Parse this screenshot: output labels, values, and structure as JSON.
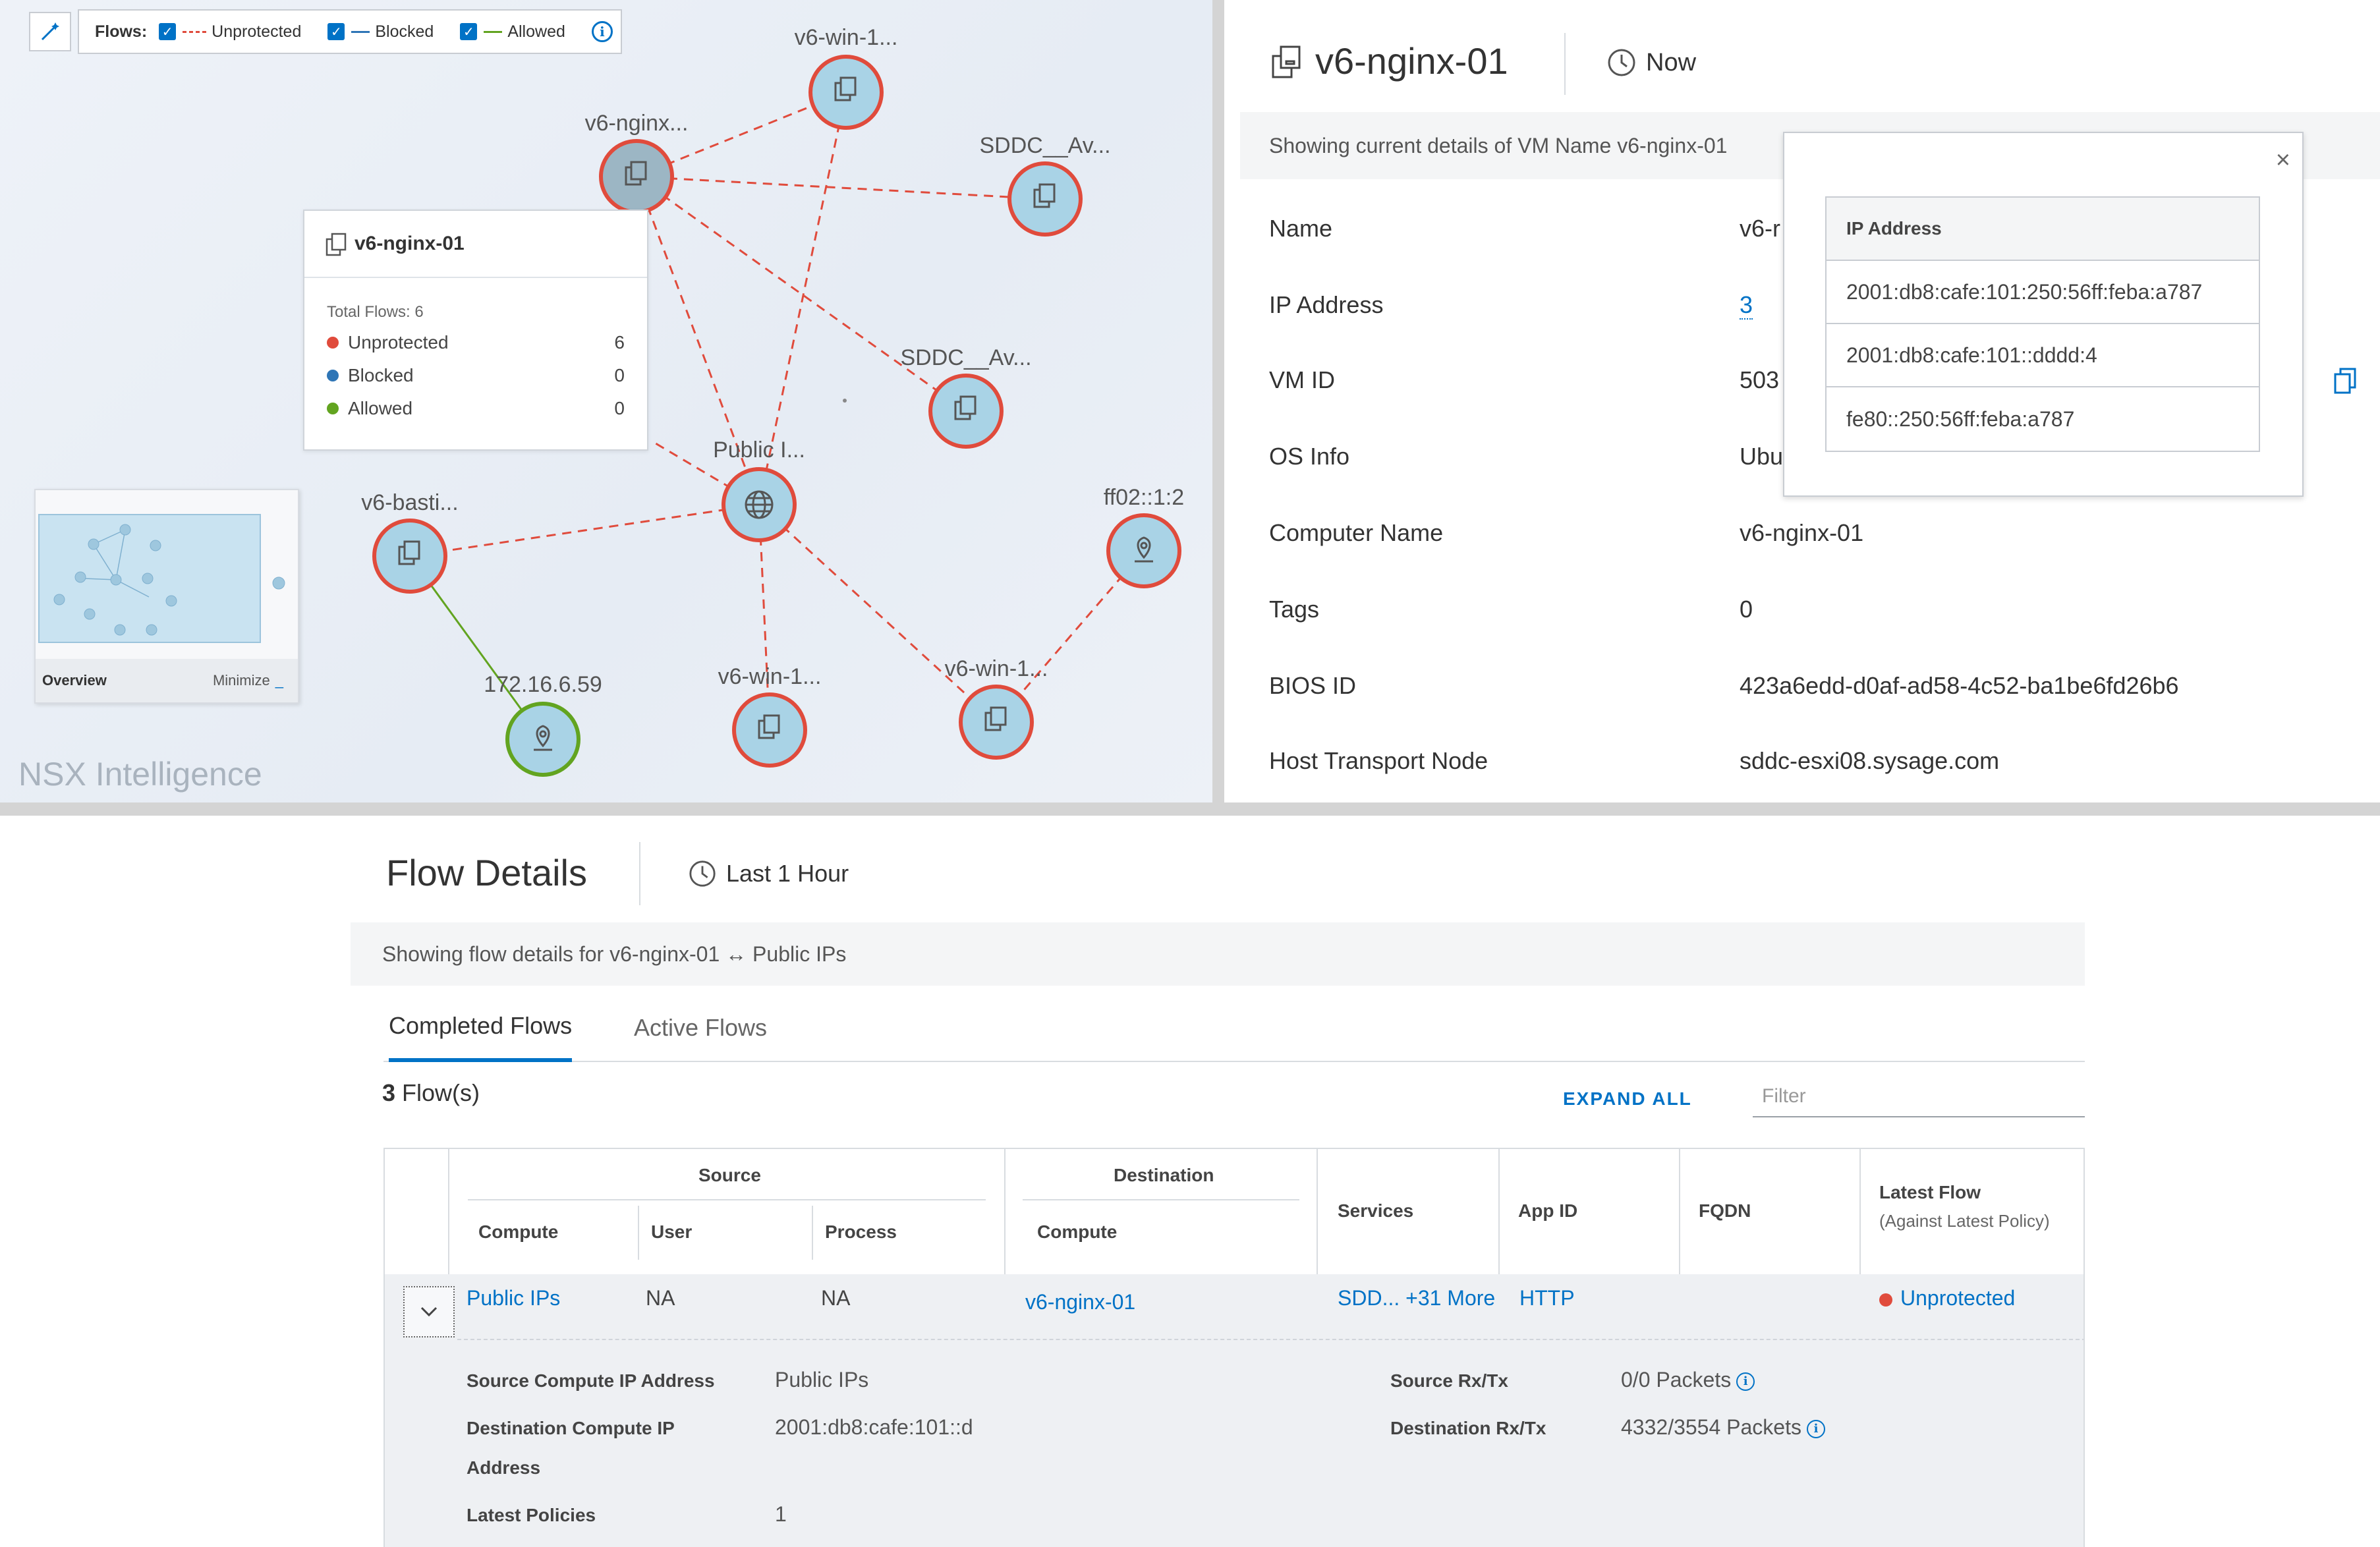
{
  "graph": {
    "legend": {
      "flows_label": "Flows:",
      "unprotected": "Unprotected",
      "blocked": "Blocked",
      "allowed": "Allowed"
    },
    "nodes": {
      "win1_top": "v6-win-1...",
      "nginx": "v6-nginx...",
      "sddc1": "SDDC__Av...",
      "sddc2": "SDDC__Av...",
      "public": "Public I...",
      "bastion": "v6-basti...",
      "ff02": "ff02::1:2",
      "ip172": "172.16.6.59",
      "win1_bottom": "v6-win-1...",
      "win1_right": "v6-win-1..."
    },
    "tooltip": {
      "title": "v6-nginx-01",
      "total": "Total Flows: 6",
      "rows": [
        {
          "label": "Unprotected",
          "count": "6",
          "color": "#e04b3c"
        },
        {
          "label": "Blocked",
          "count": "0",
          "color": "#2e75b6"
        },
        {
          "label": "Allowed",
          "count": "0",
          "color": "#62a420"
        }
      ]
    },
    "overview": {
      "title": "Overview",
      "minimize": "Minimize",
      "minimize_glyph": "_"
    },
    "brand": "NSX Intelligence"
  },
  "vm": {
    "title": "v6-nginx-01",
    "time": "Now",
    "banner": "Showing current details of VM Name v6-nginx-01",
    "rows": [
      {
        "label": "Name",
        "value": "v6-r"
      },
      {
        "label": "IP Address",
        "value": "3"
      },
      {
        "label": "VM ID",
        "value": "503"
      },
      {
        "label": "OS Info",
        "value": "Ubu"
      },
      {
        "label": "Computer Name",
        "value": "v6-nginx-01"
      },
      {
        "label": "Tags",
        "value": "0"
      },
      {
        "label": "BIOS ID",
        "value": "423a6edd-d0af-ad58-4c52-ba1be6fd26b6"
      },
      {
        "label": "Host Transport Node",
        "value": "sddc-esxi08.sysage.com"
      }
    ],
    "ip_popup": {
      "header": "IP Address",
      "close_glyph": "×",
      "items": [
        "2001:db8:cafe:101:250:56ff:feba:a787",
        "2001:db8:cafe:101::dddd:4",
        "fe80::250:56ff:feba:a787"
      ]
    }
  },
  "flow": {
    "title": "Flow Details",
    "time": "Last 1 Hour",
    "banner": "Showing flow details for v6-nginx-01 ↔ Public IPs",
    "tabs": [
      "Completed Flows",
      "Active Flows"
    ],
    "count_num": "3",
    "count_label": " Flow(s)",
    "expand_all": "EXPAND ALL",
    "filter_placeholder": "Filter",
    "headers": {
      "source": "Source",
      "destination": "Destination",
      "compute": "Compute",
      "user": "User",
      "process": "Process",
      "dest_compute": "Compute",
      "services": "Services",
      "app_id": "App ID",
      "fqdn": "FQDN",
      "latest_flow": "Latest Flow",
      "latest_flow_sub": "(Against Latest Policy)"
    },
    "row": {
      "source_compute": "Public IPs",
      "user": "NA",
      "process": "NA",
      "dest_compute": "v6-nginx-01",
      "services": "SDD...",
      "services_more": "+31 More",
      "app_id": "HTTP",
      "fqdn": "",
      "latest_flow": "Unprotected",
      "status_color": "#e04b3c"
    },
    "details": {
      "src_ip_label": "Source Compute IP Address",
      "src_ip_value": "Public IPs",
      "dst_ip_label_1": "Destination Compute IP",
      "dst_ip_label_2": "Address",
      "dst_ip_value": "2001:db8:cafe:101::d",
      "policies_label": "Latest Policies",
      "policies_value": "1",
      "src_rxtx_label": "Source Rx/Tx",
      "src_rxtx_value": "0/0 Packets",
      "dst_rxtx_label": "Destination Rx/Tx",
      "dst_rxtx_value": "4332/3554 Packets"
    }
  },
  "colors": {
    "accent": "#0072c6",
    "unprotected": "#e04b3c",
    "blocked": "#2e75b6",
    "allowed": "#62a420",
    "node_fill": "#a9d3e6"
  }
}
